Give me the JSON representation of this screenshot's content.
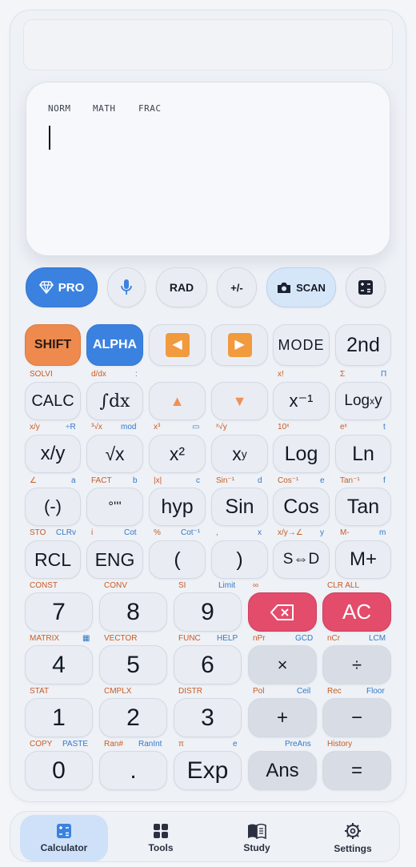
{
  "display": {
    "modes": [
      "NORM",
      "MATH",
      "FRAC"
    ]
  },
  "toolbar": {
    "pro": "PRO",
    "rad": "RAD",
    "sign": "+/-",
    "scan": "SCAN"
  },
  "keys": {
    "r1": [
      "SHIFT",
      "ALPHA",
      "◀",
      "▶",
      "MODE",
      "2nd"
    ],
    "r2": [
      "CALC",
      "∫dx",
      "▲",
      "▼",
      "x⁻¹",
      "Log"
    ],
    "r2_log_sub": "x",
    "r2_log_tail": "y",
    "r3": [
      "x/y",
      "√x",
      "x²",
      "x",
      "Log",
      "Ln"
    ],
    "r3_xy_sup": "y",
    "r4": [
      "(-)",
      "°'''",
      "hyp",
      "Sin",
      "Cos",
      "Tan"
    ],
    "r5": [
      "RCL",
      "ENG",
      "(",
      ")",
      "S⇔D",
      "M+"
    ],
    "n1": [
      "7",
      "8",
      "9",
      "AC"
    ],
    "n2": [
      "4",
      "5",
      "6",
      "×",
      "÷"
    ],
    "n3": [
      "1",
      "2",
      "3",
      "+",
      "−"
    ],
    "n4": [
      "0",
      ".",
      "Exp",
      "Ans",
      "="
    ]
  },
  "labels": {
    "l1": [
      "SOLVI",
      "d/dx",
      ":",
      "x!",
      "Σ",
      "Π"
    ],
    "l2": [
      "x/y",
      "÷R",
      "³√x",
      "mod",
      "x³",
      "▭",
      "ˣ√y",
      "10ˣ",
      "eˣ",
      "t"
    ],
    "l3": [
      "∠",
      "a",
      "FACT",
      "b",
      "|x|",
      "c",
      "Sin⁻¹",
      "d",
      "Cos⁻¹",
      "e",
      "Tan⁻¹",
      "f"
    ],
    "l4": [
      "STO",
      "CLRv",
      "i",
      "Cot",
      "%",
      "Cot⁻¹",
      ",",
      "x",
      "x/y→∠",
      "y",
      "M-",
      "m"
    ],
    "l5": [
      "CONST",
      "CONV",
      "SI",
      "Limit",
      "∞",
      "CLR ALL"
    ],
    "l6": [
      "MATRIX",
      "▦",
      "VECTOR",
      "FUNC",
      "HELP",
      "nPr",
      "GCD",
      "nCr",
      "LCM"
    ],
    "l7": [
      "STAT",
      "CMPLX",
      "DISTR",
      "Pol",
      "Ceil",
      "Rec",
      "Floor"
    ],
    "l8": [
      "COPY",
      "PASTE",
      "Ran#",
      "RanInt",
      "π",
      "e",
      "PreAns",
      "History"
    ]
  },
  "nav": [
    "Calculator",
    "Tools",
    "Study",
    "Settings"
  ],
  "colors": {
    "accent_blue": "#3b82e0",
    "shift_orange": "#ee8a4e",
    "arrow_orange": "#f19a3e",
    "ac_red": "#e34c6b"
  }
}
